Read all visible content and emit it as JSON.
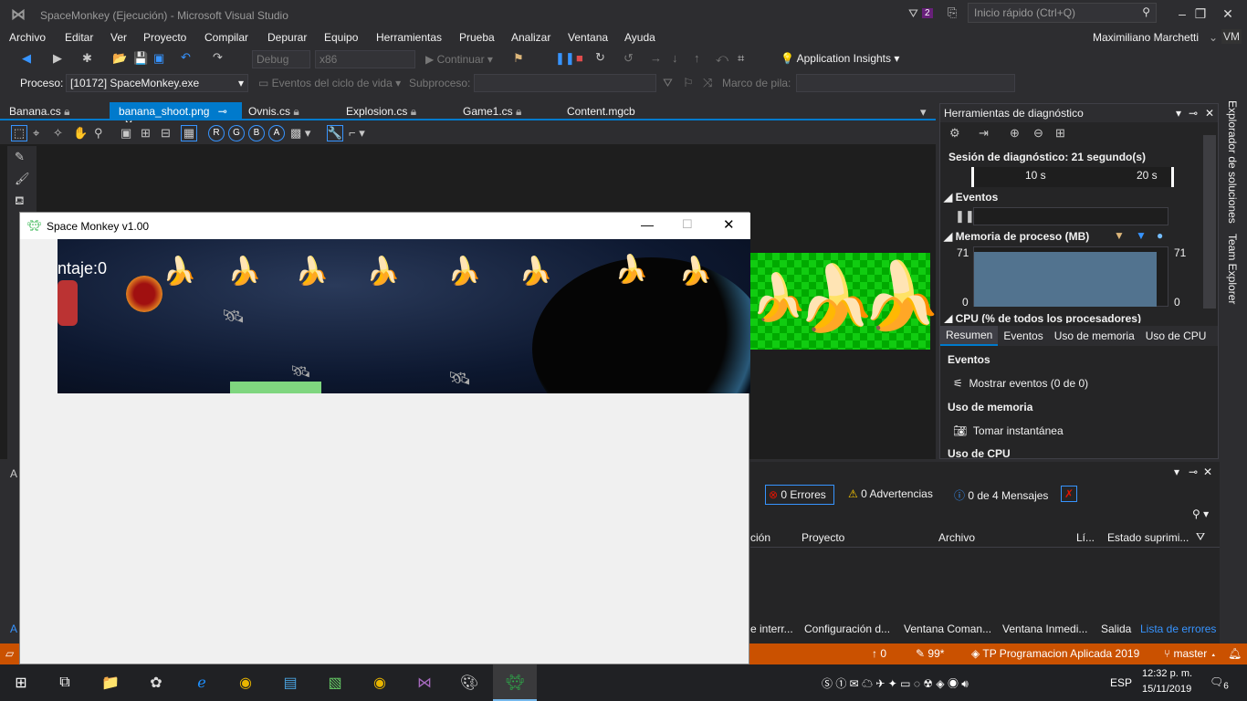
{
  "window": {
    "title": "SpaceMonkey (Ejecución) - Microsoft Visual Studio",
    "notifications": "2",
    "quick_launch": "Inicio rápido (Ctrl+Q)",
    "user": "Maximiliano Marchetti",
    "user_initials": "VM"
  },
  "menu": [
    "Archivo",
    "Editar",
    "Ver",
    "Proyecto",
    "Compilar",
    "Depurar",
    "Equipo",
    "Herramientas",
    "Prueba",
    "Analizar",
    "Ventana",
    "Ayuda"
  ],
  "toolbar": {
    "config": "Debug",
    "platform": "x86",
    "continue": "Continuar",
    "app_insights": "Application Insights"
  },
  "toolbar2": {
    "process_label": "Proceso:",
    "process": "[10172] SpaceMonkey.exe",
    "lifecycle": "Eventos del ciclo de vida",
    "thread_label": "Subproceso:",
    "stack_label": "Marco de pila:"
  },
  "tabs": [
    "Banana.cs",
    "banana_shoot.png",
    "Ovnis.cs",
    "Explosion.cs",
    "Game1.cs",
    "Content.mgcb"
  ],
  "image_tools": {
    "channels": [
      "R",
      "G",
      "B",
      "A"
    ]
  },
  "diagnostics": {
    "title": "Herramientas de diagnóstico",
    "session": "Sesión de diagnóstico: 21 segundo(s)",
    "tick_10": "10 s",
    "tick_20": "20 s",
    "events": "Eventos",
    "memory": "Memoria de proceso (MB)",
    "mem_max": "71",
    "mem_min": "0",
    "cpu": "CPU (% de todos los procesadores)",
    "tabs": [
      "Resumen",
      "Eventos",
      "Uso de memoria",
      "Uso de CPU"
    ],
    "sec_events": "Eventos",
    "show_events": "Mostrar eventos (0 de 0)",
    "sec_memory": "Uso de memoria",
    "snapshot": "Tomar instantánea",
    "sec_cpu": "Uso de CPU"
  },
  "errors": {
    "errors": "0 Errores",
    "warnings": "0 Advertencias",
    "messages": "0 de 4 Mensajes",
    "cols": [
      "ción",
      "Proyecto",
      "Archivo",
      "Lí...",
      "Estado suprimi..."
    ]
  },
  "bottom_tabs": [
    "e interr...",
    "Configuración d...",
    "Ventana Coman...",
    "Ventana Inmedi...",
    "Salida",
    "Lista de errores"
  ],
  "status": {
    "errors": "0",
    "changes": "99*",
    "repo": "TP Programacion Aplicada 2019",
    "branch": "master"
  },
  "game": {
    "title": "Space Monkey v1.00",
    "score": "ntaje:0"
  },
  "taskbar": {
    "lang": "ESP",
    "time": "12:32 p. m.",
    "date": "15/11/2019",
    "notif": "6"
  },
  "side_tabs": [
    "Explorador de soluciones",
    "Team Explorer"
  ]
}
